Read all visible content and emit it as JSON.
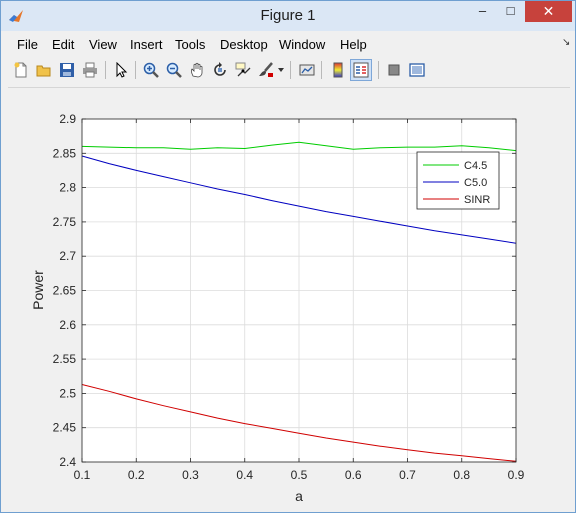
{
  "window": {
    "title": "Figure 1",
    "minimize": "–",
    "maximize": "□",
    "close": "✕"
  },
  "menu": [
    "File",
    "Edit",
    "View",
    "Insert",
    "Tools",
    "Desktop",
    "Window",
    "Help"
  ],
  "toolbar": [
    "new-figure-icon",
    "open-icon",
    "save-icon",
    "print-icon",
    "pointer-icon",
    "zoom-in-icon",
    "zoom-out-icon",
    "pan-icon",
    "rotate-icon",
    "data-cursor-icon",
    "brush-icon",
    "link-icon",
    "colorbar-icon",
    "legend-icon",
    "hide-plot-tools-icon",
    "show-plot-tools-icon"
  ],
  "chart_data": {
    "type": "line",
    "xlabel": "a",
    "ylabel": "Power",
    "xlim": [
      0.1,
      0.9
    ],
    "ylim": [
      2.4,
      2.9
    ],
    "xticks": [
      "0.1",
      "0.2",
      "0.3",
      "0.4",
      "0.5",
      "0.6",
      "0.7",
      "0.8",
      "0.9"
    ],
    "yticks": [
      "2.4",
      "2.45",
      "2.5",
      "2.55",
      "2.6",
      "2.65",
      "2.7",
      "2.75",
      "2.8",
      "2.85",
      "2.9"
    ],
    "grid": true,
    "legend": "top-right",
    "x": [
      0.1,
      0.15,
      0.2,
      0.25,
      0.3,
      0.35,
      0.4,
      0.45,
      0.5,
      0.55,
      0.6,
      0.65,
      0.7,
      0.75,
      0.8,
      0.85,
      0.9
    ],
    "series": [
      {
        "name": "C4.5",
        "color": "#00cc00",
        "values": [
          2.86,
          2.859,
          2.858,
          2.858,
          2.856,
          2.858,
          2.857,
          2.862,
          2.866,
          2.861,
          2.856,
          2.858,
          2.859,
          2.859,
          2.861,
          2.858,
          2.854
        ]
      },
      {
        "name": "C5.0",
        "color": "#0000c0",
        "values": [
          2.846,
          2.835,
          2.825,
          2.816,
          2.807,
          2.798,
          2.79,
          2.781,
          2.773,
          2.765,
          2.758,
          2.751,
          2.744,
          2.737,
          2.731,
          2.725,
          2.719
        ]
      },
      {
        "name": "SINR",
        "color": "#d00000",
        "values": [
          2.513,
          2.503,
          2.492,
          2.482,
          2.473,
          2.464,
          2.456,
          2.449,
          2.442,
          2.435,
          2.429,
          2.423,
          2.418,
          2.413,
          2.409,
          2.405,
          2.401
        ]
      }
    ]
  }
}
